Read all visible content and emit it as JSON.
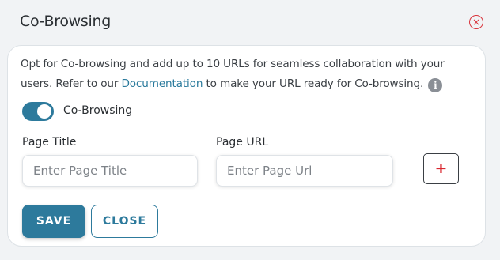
{
  "dialog": {
    "title": "Co-Browsing",
    "close_icon": "close-circle-icon",
    "close_glyph": "×"
  },
  "description": {
    "text_before_link": "Opt for Co-browsing and add up to 10 URLs for seamless collaboration with your users. Refer to our ",
    "link_text": "Documentation",
    "text_after_link": " to make your URL ready for Co-browsing.",
    "info_icon": "info-icon",
    "info_glyph": "i"
  },
  "cobrowsing_toggle": {
    "label": "Co-Browsing",
    "enabled": true
  },
  "form": {
    "page_title": {
      "label": "Page Title",
      "placeholder": "Enter Page Title",
      "value": ""
    },
    "page_url": {
      "label": "Page URL",
      "placeholder": "Enter Page Url",
      "value": ""
    },
    "add_button": {
      "icon": "plus-icon",
      "glyph": "+"
    }
  },
  "actions": {
    "save_label": "SAVE",
    "close_label": "CLOSE"
  },
  "colors": {
    "accent": "#2d7a9c",
    "danger": "#d9363e",
    "link": "#2a7a9c"
  }
}
